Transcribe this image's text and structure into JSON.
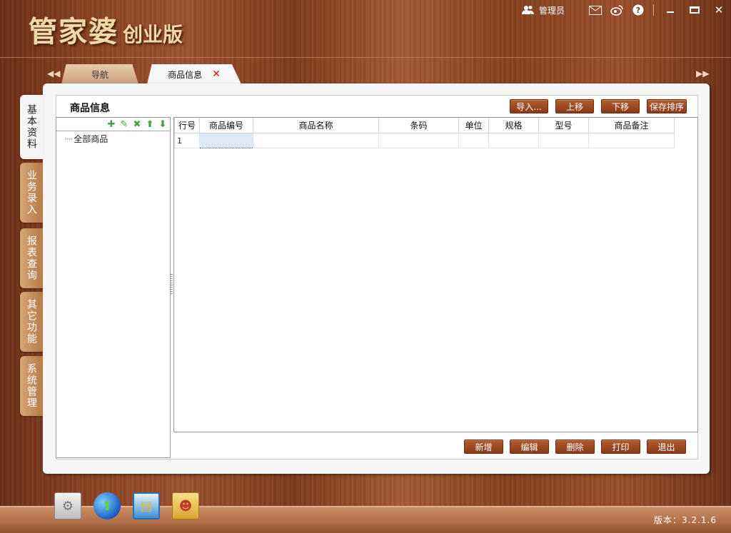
{
  "app": {
    "logo_main": "管家婆",
    "logo_sub": "创业版",
    "version": "版本：3.2.1.6"
  },
  "topbar": {
    "user": "管理员",
    "icons": [
      "user-icon",
      "mail-icon",
      "weibo-icon",
      "help-icon",
      "minimize-icon",
      "maximize-icon",
      "close-icon"
    ]
  },
  "tabs": [
    {
      "label": "导航"
    },
    {
      "label": "商品信息",
      "close": "✕"
    }
  ],
  "side_tabs": [
    "基本资料",
    "业务录入",
    "报表查询",
    "其它功能",
    "系统管理"
  ],
  "page": {
    "title": "商品信息"
  },
  "toolbar": {
    "import": "导入...",
    "move_up": "上移",
    "move_down": "下移",
    "save_order": "保存排序"
  },
  "tree": {
    "root": "全部商品",
    "tools": [
      "add-icon",
      "edit-icon",
      "delete-icon",
      "up-arrow-icon",
      "down-arrow-icon"
    ]
  },
  "grid": {
    "columns": [
      "行号",
      "商品编号",
      "商品名称",
      "条码",
      "单位",
      "规格",
      "型号",
      "商品备注"
    ],
    "rows": [
      [
        "1",
        "",
        "",
        "",
        "",
        "",
        "",
        ""
      ]
    ]
  },
  "actions": {
    "add": "新增",
    "edit": "编辑",
    "delete": "删除",
    "print": "打印",
    "exit": "退出"
  },
  "dock": [
    "settings-icon",
    "globe-upload-icon",
    "database-icon",
    "user-transfer-icon"
  ]
}
